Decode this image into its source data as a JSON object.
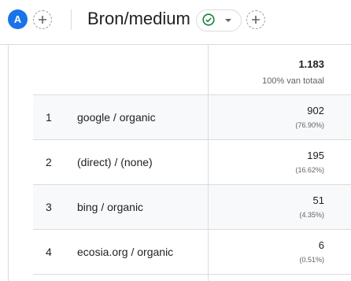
{
  "header": {
    "avatar_letter": "A",
    "dimension_title": "Bron/medium"
  },
  "table": {
    "total_value": "1.183",
    "total_label": "100% van totaal",
    "rows": [
      {
        "index": "1",
        "name": "google / organic",
        "value": "902",
        "percent": "(76.90%)"
      },
      {
        "index": "2",
        "name": "(direct) / (none)",
        "value": "195",
        "percent": "(16.62%)"
      },
      {
        "index": "3",
        "name": "bing / organic",
        "value": "51",
        "percent": "(4.35%)"
      },
      {
        "index": "4",
        "name": "ecosia.org / organic",
        "value": "6",
        "percent": "(0.51%)"
      }
    ]
  },
  "colors": {
    "accent": "#1a73e8",
    "check": "#188038",
    "divider": "#dadce0"
  }
}
